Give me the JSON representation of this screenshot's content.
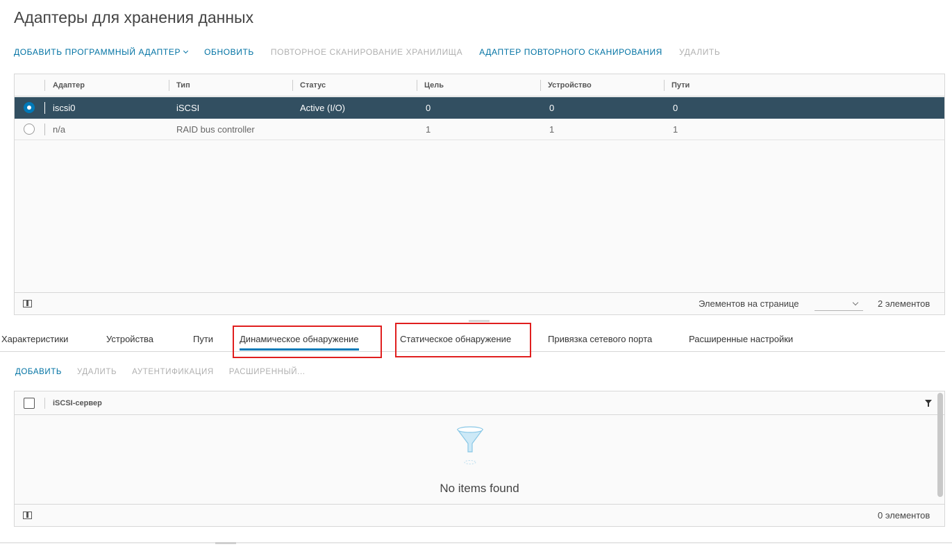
{
  "page_title": "Адаптеры для хранения данных",
  "toolbar": [
    {
      "label": "ДОБАВИТЬ ПРОГРАММНЫЙ АДАПТЕР",
      "enabled": true,
      "has_caret": true
    },
    {
      "label": "ОБНОВИТЬ",
      "enabled": true
    },
    {
      "label": "ПОВТОРНОЕ СКАНИРОВАНИЕ ХРАНИЛИЩА",
      "enabled": false
    },
    {
      "label": "АДАПТЕР ПОВТОРНОГО СКАНИРОВАНИЯ",
      "enabled": true
    },
    {
      "label": "УДАЛИТЬ",
      "enabled": false
    }
  ],
  "adapters_grid": {
    "columns": [
      "Адаптер",
      "Тип",
      "Статус",
      "Цель",
      "Устройство",
      "Пути"
    ],
    "rows": [
      {
        "adapter": "iscsi0",
        "type": "iSCSI",
        "status": "Active (I/O)",
        "target": "0",
        "device": "0",
        "paths": "0",
        "selected": true
      },
      {
        "adapter": "n/a",
        "type": "RAID bus controller",
        "status": "",
        "target": "1",
        "device": "1",
        "paths": "1",
        "selected": false
      }
    ],
    "footer": {
      "per_page_label": "Элементов на странице",
      "count_label": "2 элементов"
    }
  },
  "tabs": [
    {
      "label": "Характеристики",
      "active": false
    },
    {
      "label": "Устройства",
      "active": false
    },
    {
      "label": "Пути",
      "active": false
    },
    {
      "label": "Динамическое обнаружение",
      "active": true
    },
    {
      "label": "Статическое обнаружение",
      "active": false
    },
    {
      "label": "Привязка сетевого порта",
      "active": false
    },
    {
      "label": "Расширенные настройки",
      "active": false
    }
  ],
  "sub_toolbar": [
    {
      "label": "ДОБАВИТЬ",
      "enabled": true
    },
    {
      "label": "УДАЛИТЬ",
      "enabled": false
    },
    {
      "label": "АУТЕНТИФИКАЦИЯ",
      "enabled": false
    },
    {
      "label": "РАСШИРЕННЫЙ...",
      "enabled": false
    }
  ],
  "servers_grid": {
    "column": "iSCSI-сервер",
    "empty_message": "No items found",
    "count_label": "0 элементов"
  },
  "colors": {
    "accent": "#0079b8",
    "selected_row": "#324f61",
    "highlight": "#e01e1e"
  }
}
